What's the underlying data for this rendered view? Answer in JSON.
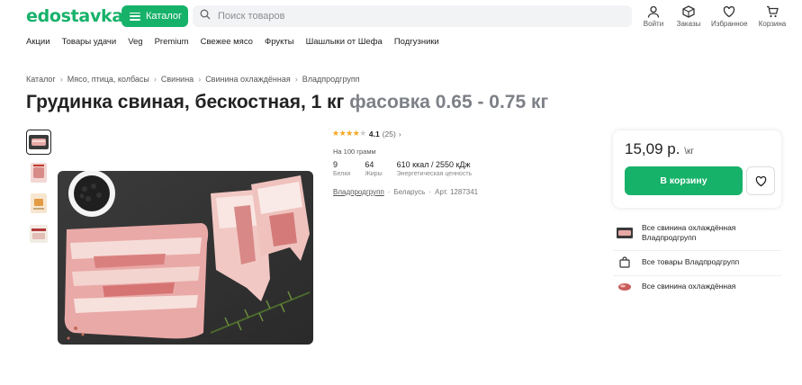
{
  "header": {
    "logo": "edostavka",
    "catalog_label": "Каталог",
    "search_placeholder": "Поиск товаров",
    "icons": [
      {
        "name": "user-icon",
        "label": "Войти"
      },
      {
        "name": "box-icon",
        "label": "Заказы"
      },
      {
        "name": "heart-icon",
        "label": "Избранное"
      },
      {
        "name": "cart-icon",
        "label": "Корзина"
      }
    ]
  },
  "nav": [
    "Акции",
    "Товары удачи",
    "Veg",
    "Premium",
    "Свежее мясо",
    "Фрукты",
    "Шашлыки от Шефа",
    "Подгузники"
  ],
  "breadcrumbs": [
    "Каталог",
    "Мясо, птица, колбасы",
    "Свинина",
    "Свинина охлаждённая",
    "Владпродгрупп"
  ],
  "product": {
    "title": "Грудинка свиная, бескостная, 1 кг",
    "pack": "фасовка 0.65 - 0.75 кг",
    "rating": "4.1",
    "rating_value": 4.1,
    "reviews": "(25)",
    "per100": "На 100 грамм",
    "nutrition": [
      {
        "value": "9",
        "label": "Белки"
      },
      {
        "value": "64",
        "label": "Жиры"
      },
      {
        "value": "610 ккал / 2550 кДж",
        "label": "Энергетическая ценность"
      }
    ],
    "brand": "Владпродгрупп",
    "country": "Беларусь",
    "article": "Арт. 1287341"
  },
  "buy": {
    "price": "15,09 р.",
    "unit": "\\кг",
    "cart_label": "В корзину"
  },
  "links": [
    {
      "text": "Все свинина охлаждённая Владпродгрупп",
      "icon": "meat-thumb-icon"
    },
    {
      "text": "Все товары Владпродгрупп",
      "icon": "bag-icon"
    },
    {
      "text": "Все свинина охлаждённая",
      "icon": "meat-icon"
    }
  ],
  "colors": {
    "accent": "#17b26a",
    "star": "#f5a623"
  }
}
